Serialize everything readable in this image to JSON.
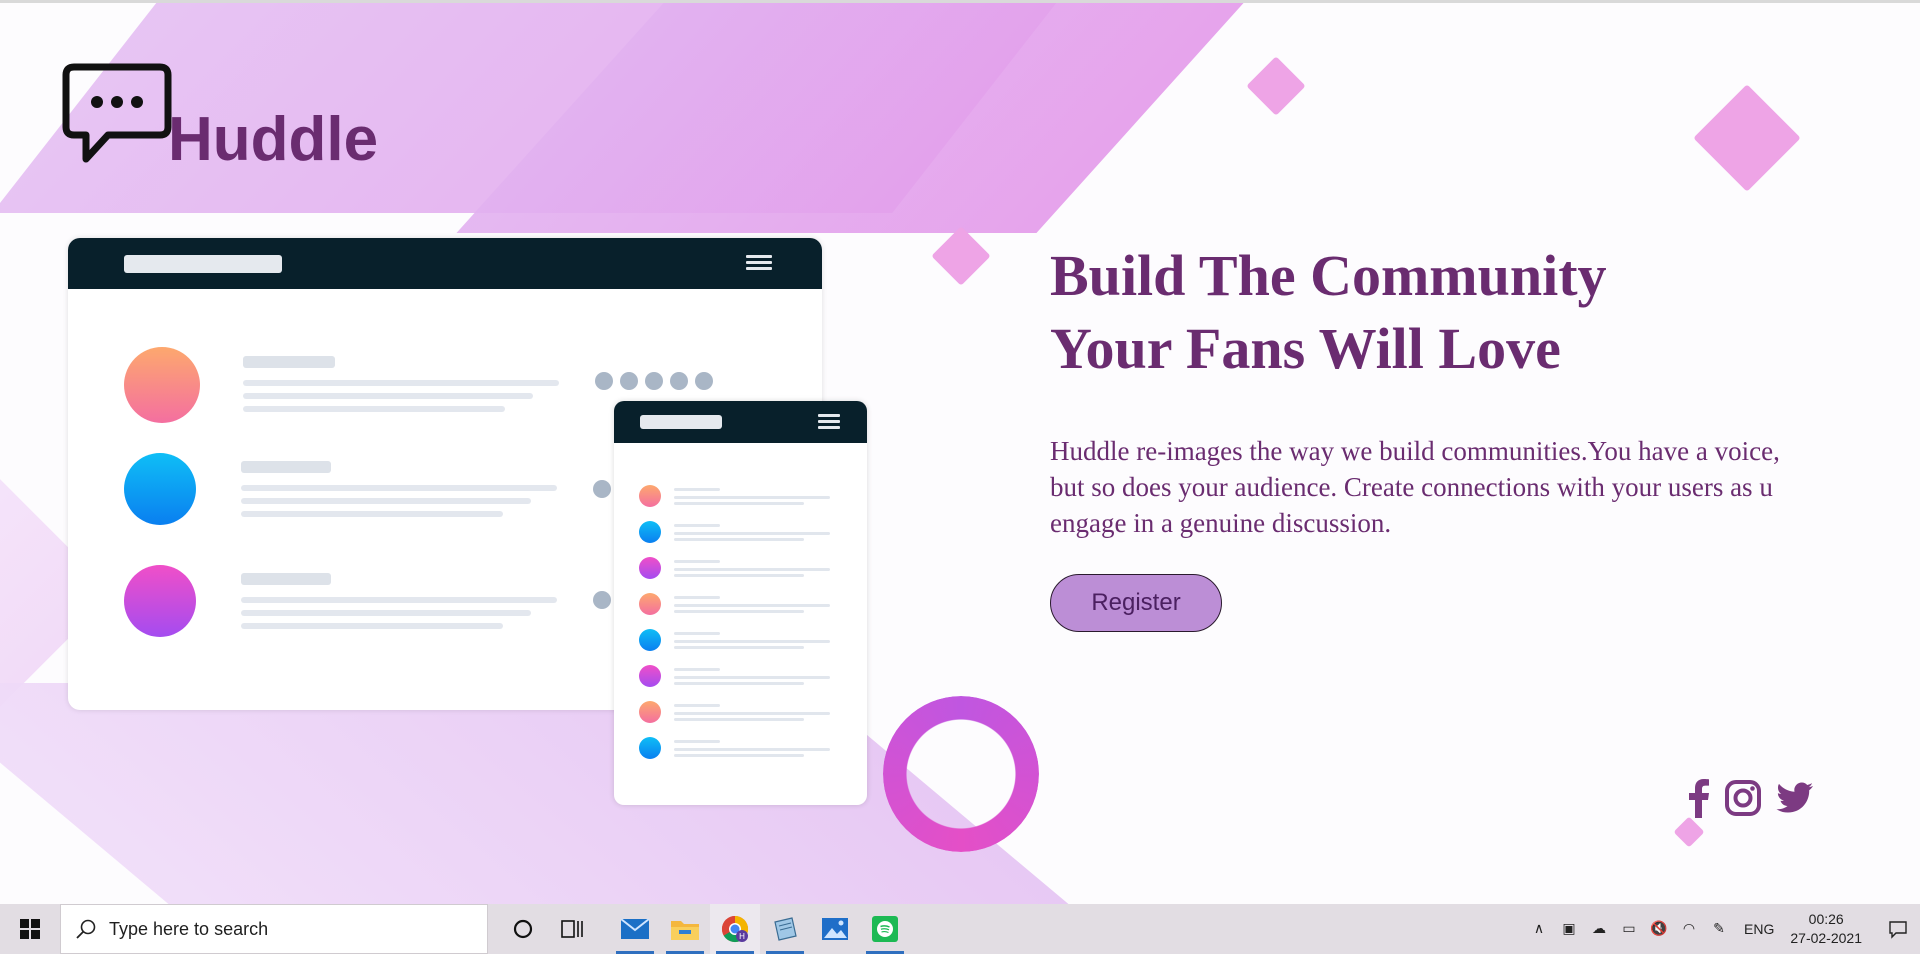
{
  "brand": {
    "name": "Huddle"
  },
  "hero": {
    "headline_line1": "Build The Community",
    "headline_line2": "Your Fans Will Love",
    "description": "Huddle re-images the way we build communities.You have a voice, but so does your audience. Create connections with your users as u engage in a genuine discussion.",
    "register_label": "Register"
  },
  "social": [
    "facebook-icon",
    "instagram-icon",
    "twitter-icon"
  ],
  "colors": {
    "brand": "#6a2c70",
    "button": "#bc8ed6",
    "mockup_bar": "#08202b"
  },
  "taskbar": {
    "search_placeholder": "Type here to search",
    "apps": [
      "mail-icon",
      "file-explorer-icon",
      "chrome-icon",
      "notepad-icon",
      "photos-icon",
      "spotify-icon"
    ],
    "language": "ENG",
    "time": "00:26",
    "date": "27-02-2021"
  }
}
